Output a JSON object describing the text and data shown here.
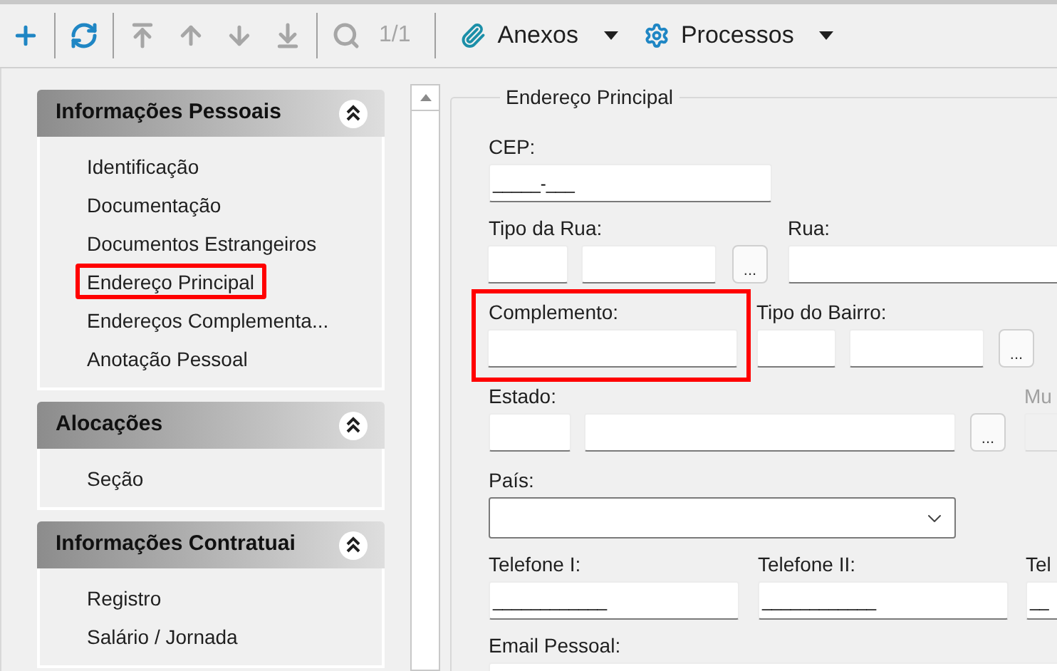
{
  "toolbar": {
    "buttons": [
      {
        "kind": "add",
        "disabled": false
      },
      {
        "kind": "refresh",
        "disabled": false
      },
      {
        "kind": "first",
        "disabled": true
      },
      {
        "kind": "previous",
        "disabled": true
      },
      {
        "kind": "next",
        "disabled": true
      },
      {
        "kind": "last",
        "disabled": true
      },
      {
        "kind": "search",
        "disabled": true
      }
    ],
    "record_counter": "1/1",
    "menus": [
      {
        "kind": "attachments",
        "label": "Anexos"
      },
      {
        "kind": "processes",
        "label": "Processos"
      }
    ]
  },
  "sidebar": {
    "sections": [
      {
        "title": "Informações Pessoais",
        "expanded": true,
        "items": [
          {
            "label": "Identificação",
            "selected": false
          },
          {
            "label": "Documentação",
            "selected": false
          },
          {
            "label": "Documentos Estrangeiros",
            "selected": false
          },
          {
            "label": "Endereço Principal",
            "selected": true
          },
          {
            "label": "Endereços Complementa...",
            "selected": false
          },
          {
            "label": "Anotação Pessoal",
            "selected": false
          }
        ]
      },
      {
        "title": "Alocações",
        "expanded": true,
        "items": [
          {
            "label": "Seção",
            "selected": false
          }
        ]
      },
      {
        "title": "Informações Contratuai",
        "expanded": true,
        "items": [
          {
            "label": "Registro",
            "selected": false
          },
          {
            "label": "Salário / Jornada",
            "selected": false
          }
        ]
      }
    ]
  },
  "form": {
    "title": "Endereço Principal",
    "cep": {
      "label": "CEP:",
      "value": "_____-___"
    },
    "tipo_da_rua": {
      "label": "Tipo da Rua:",
      "lookup_button": "..."
    },
    "rua": {
      "label": "Rua:"
    },
    "complemento": {
      "label": "Complemento:",
      "highlighted": true
    },
    "tipo_do_bairro": {
      "label": "Tipo do Bairro:",
      "lookup_button": "..."
    },
    "estado": {
      "label": "Estado:",
      "lookup_button": "..."
    },
    "municipio": {
      "label": "Mu",
      "disabled": true
    },
    "pais": {
      "label": "País:"
    },
    "telefones": [
      {
        "label": "Telefone I:",
        "value": "____________"
      },
      {
        "label": "Telefone II:",
        "value": "____________"
      },
      {
        "label": "Tel",
        "value": "__"
      }
    ],
    "email": {
      "label": "Email Pessoal:"
    }
  }
}
